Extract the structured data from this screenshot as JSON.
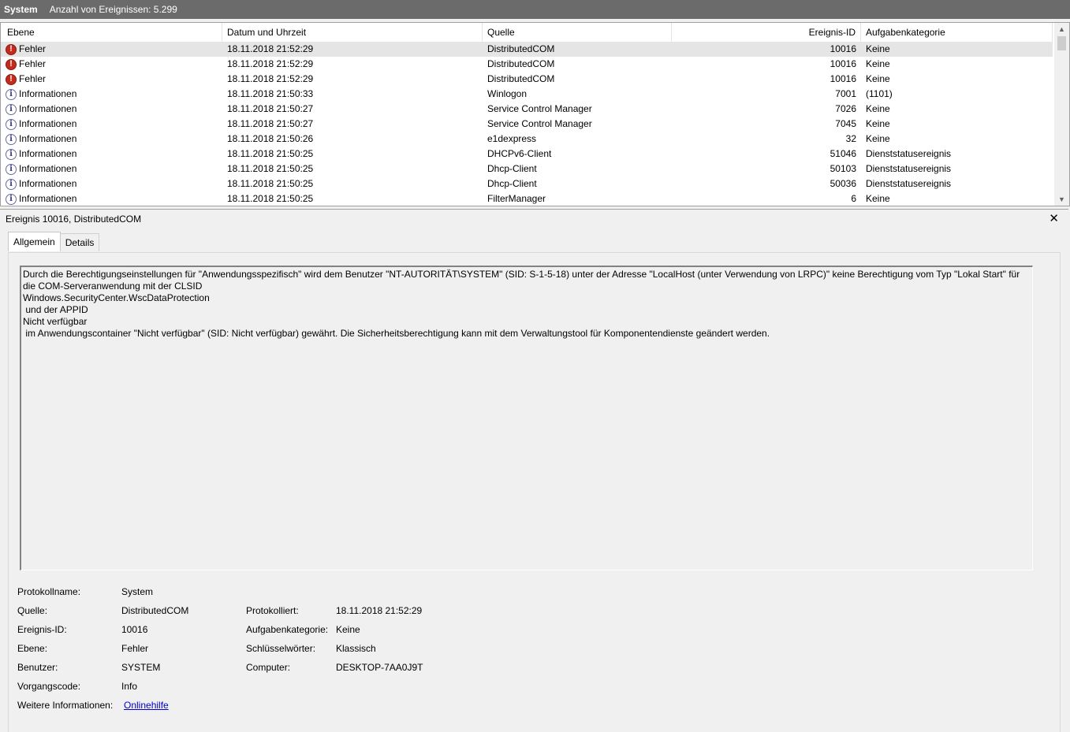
{
  "title_bar": {
    "log_name": "System",
    "event_count": "Anzahl von Ereignissen: 5.299"
  },
  "columns": {
    "level": "Ebene",
    "date": "Datum und Uhrzeit",
    "source": "Quelle",
    "event_id": "Ereignis-ID",
    "category": "Aufgabenkategorie"
  },
  "events": [
    {
      "level": "Fehler",
      "icon": "error-icon",
      "date": "18.11.2018 21:52:29",
      "source": "DistributedCOM",
      "id": "10016",
      "category": "Keine"
    },
    {
      "level": "Fehler",
      "icon": "error-icon",
      "date": "18.11.2018 21:52:29",
      "source": "DistributedCOM",
      "id": "10016",
      "category": "Keine"
    },
    {
      "level": "Fehler",
      "icon": "error-icon",
      "date": "18.11.2018 21:52:29",
      "source": "DistributedCOM",
      "id": "10016",
      "category": "Keine"
    },
    {
      "level": "Informationen",
      "icon": "info-icon",
      "date": "18.11.2018 21:50:33",
      "source": "Winlogon",
      "id": "7001",
      "category": "(1101)"
    },
    {
      "level": "Informationen",
      "icon": "info-icon",
      "date": "18.11.2018 21:50:27",
      "source": "Service Control Manager",
      "id": "7026",
      "category": "Keine"
    },
    {
      "level": "Informationen",
      "icon": "info-icon",
      "date": "18.11.2018 21:50:27",
      "source": "Service Control Manager",
      "id": "7045",
      "category": "Keine"
    },
    {
      "level": "Informationen",
      "icon": "info-icon",
      "date": "18.11.2018 21:50:26",
      "source": "e1dexpress",
      "id": "32",
      "category": "Keine"
    },
    {
      "level": "Informationen",
      "icon": "info-icon",
      "date": "18.11.2018 21:50:25",
      "source": "DHCPv6-Client",
      "id": "51046",
      "category": "Dienststatusereignis"
    },
    {
      "level": "Informationen",
      "icon": "info-icon",
      "date": "18.11.2018 21:50:25",
      "source": "Dhcp-Client",
      "id": "50103",
      "category": "Dienststatusereignis"
    },
    {
      "level": "Informationen",
      "icon": "info-icon",
      "date": "18.11.2018 21:50:25",
      "source": "Dhcp-Client",
      "id": "50036",
      "category": "Dienststatusereignis"
    },
    {
      "level": "Informationen",
      "icon": "info-icon",
      "date": "18.11.2018 21:50:25",
      "source": "FilterManager",
      "id": "6",
      "category": "Keine"
    }
  ],
  "detail": {
    "title": "Ereignis 10016, DistributedCOM",
    "tabs": [
      "Allgemein",
      "Details"
    ],
    "message": "Durch die Berechtigungseinstellungen für \"Anwendungsspezifisch\" wird dem Benutzer \"NT-AUTORITÄT\\SYSTEM\" (SID: S-1-5-18) unter der Adresse \"LocalHost (unter Verwendung von LRPC)\" keine Berechtigung vom Typ \"Lokal Start\" für die COM-Serveranwendung mit der CLSID\nWindows.SecurityCenter.WscDataProtection\n und der APPID\nNicht verfügbar\n im Anwendungscontainer \"Nicht verfügbar\" (SID: Nicht verfügbar) gewährt. Die Sicherheitsberechtigung kann mit dem Verwaltungstool für Komponentendienste geändert werden.",
    "props": {
      "protokollname_label": "Protokollname:",
      "protokollname_value": "System",
      "quelle_label": "Quelle:",
      "quelle_value": "DistributedCOM",
      "protokolliert_label": "Protokolliert:",
      "protokolliert_value": "18.11.2018 21:52:29",
      "ereignis_id_label": "Ereignis-ID:",
      "ereignis_id_value": "10016",
      "aufgabenkategorie_label": "Aufgabenkategorie:",
      "aufgabenkategorie_value": "Keine",
      "ebene_label": "Ebene:",
      "ebene_value": "Fehler",
      "schluesselwoerter_label": "Schlüsselwörter:",
      "schluesselwoerter_value": "Klassisch",
      "benutzer_label": "Benutzer:",
      "benutzer_value": "SYSTEM",
      "computer_label": "Computer:",
      "computer_value": "DESKTOP-7AA0J9T",
      "vorgangscode_label": "Vorgangscode:",
      "vorgangscode_value": "Info",
      "weitere_label": "Weitere Informationen:",
      "weitere_link": "Onlinehilfe"
    }
  }
}
